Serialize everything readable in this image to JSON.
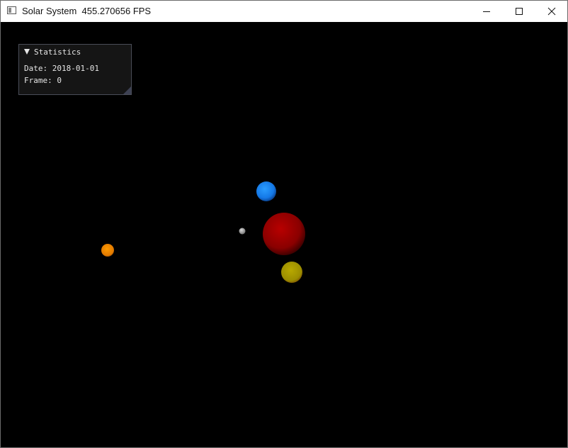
{
  "window": {
    "title": "Solar System  455.270656 FPS"
  },
  "statistics_panel": {
    "header": "Statistics",
    "date_line": "Date: 2018-01-01",
    "frame_line": "Frame: 0"
  },
  "colors": {
    "sun": "#b00000",
    "earth_blue": "#1f8fff",
    "yellow": "#b4a400",
    "orange": "#f08c00",
    "gray": "#aaaaaa"
  }
}
